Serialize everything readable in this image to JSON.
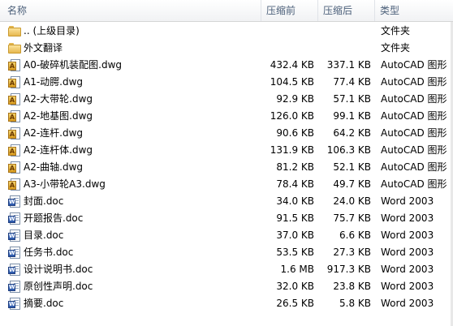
{
  "header": {
    "name": "名称",
    "compressed": "压缩前",
    "uncompressed": "压缩后",
    "type": "类型"
  },
  "rows": [
    {
      "icon": "folder-icon",
      "name": ".. (上级目录)",
      "size_before": "",
      "size_after": "",
      "type": "文件夹"
    },
    {
      "icon": "folder-icon",
      "name": "外文翻译",
      "size_before": "",
      "size_after": "",
      "type": "文件夹"
    },
    {
      "icon": "dwg-file-icon",
      "name": "A0-破碎机装配图.dwg",
      "size_before": "432.4 KB",
      "size_after": "337.1 KB",
      "type": "AutoCAD 图形"
    },
    {
      "icon": "dwg-file-icon",
      "name": "A1-动腭.dwg",
      "size_before": "104.5 KB",
      "size_after": "77.4 KB",
      "type": "AutoCAD 图形"
    },
    {
      "icon": "dwg-file-icon",
      "name": "A2-大带轮.dwg",
      "size_before": "92.9 KB",
      "size_after": "57.1 KB",
      "type": "AutoCAD 图形"
    },
    {
      "icon": "dwg-file-icon",
      "name": "A2-地基图.dwg",
      "size_before": "126.0 KB",
      "size_after": "99.1 KB",
      "type": "AutoCAD 图形"
    },
    {
      "icon": "dwg-file-icon",
      "name": "A2-连杆.dwg",
      "size_before": "90.6 KB",
      "size_after": "64.2 KB",
      "type": "AutoCAD 图形"
    },
    {
      "icon": "dwg-file-icon",
      "name": "A2-连杆体.dwg",
      "size_before": "131.9 KB",
      "size_after": "106.3 KB",
      "type": "AutoCAD 图形"
    },
    {
      "icon": "dwg-file-icon",
      "name": "A2-曲轴.dwg",
      "size_before": "81.2 KB",
      "size_after": "52.1 KB",
      "type": "AutoCAD 图形"
    },
    {
      "icon": "dwg-file-icon",
      "name": "A3-小带轮A3.dwg",
      "size_before": "78.4 KB",
      "size_after": "49.7 KB",
      "type": "AutoCAD 图形"
    },
    {
      "icon": "word-doc-icon",
      "name": "封面.doc",
      "size_before": "34.0 KB",
      "size_after": "24.0 KB",
      "type": "Word 2003"
    },
    {
      "icon": "word-doc-icon",
      "name": "开题报告.doc",
      "size_before": "91.5 KB",
      "size_after": "75.7 KB",
      "type": "Word 2003"
    },
    {
      "icon": "word-doc-icon",
      "name": "目录.doc",
      "size_before": "37.0 KB",
      "size_after": "6.6 KB",
      "type": "Word 2003"
    },
    {
      "icon": "word-doc-icon",
      "name": "任务书.doc",
      "size_before": "53.5 KB",
      "size_after": "27.3 KB",
      "type": "Word 2003"
    },
    {
      "icon": "word-doc-icon",
      "name": "设计说明书.doc",
      "size_before": "1.6 MB",
      "size_after": "917.3 KB",
      "type": "Word 2003"
    },
    {
      "icon": "word-doc-icon",
      "name": "原创性声明.doc",
      "size_before": "32.0 KB",
      "size_after": "23.8 KB",
      "type": "Word 2003"
    },
    {
      "icon": "word-doc-icon",
      "name": "摘要.doc",
      "size_before": "26.5 KB",
      "size_after": "5.8 KB",
      "type": "Word 2003"
    }
  ]
}
